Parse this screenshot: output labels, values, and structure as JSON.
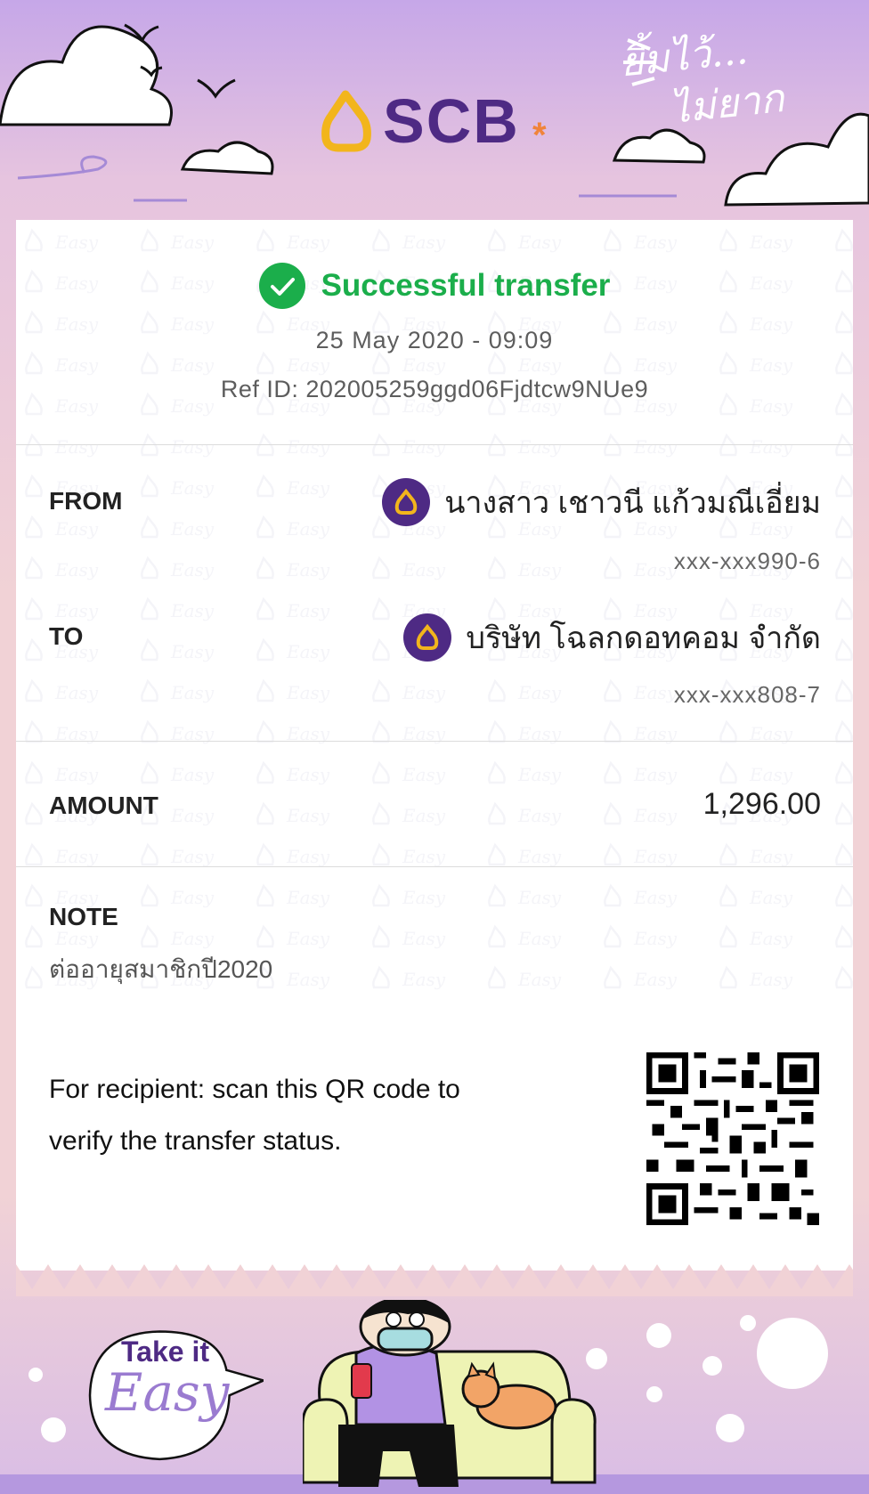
{
  "header": {
    "brand": "SCB",
    "slogan_line1": "ยิ้มไว้...",
    "slogan_line2": "ไม่ยาก"
  },
  "status": {
    "title": "Successful transfer",
    "datetime": "25 May 2020 - 09:09",
    "ref": "Ref ID: 202005259ggd06Fjdtcw9NUe9"
  },
  "from": {
    "label": "FROM",
    "name": "นางสาว เชาวนี แก้วมณีเอี่ยม",
    "account": "xxx-xxx990-6"
  },
  "to": {
    "label": "TO",
    "name": "บริษัท โฉลกดอทคอม จำกัด",
    "account": "xxx-xxx808-7"
  },
  "amount": {
    "label": "AMOUNT",
    "value": "1,296.00"
  },
  "note": {
    "label": "NOTE",
    "value": "ต่ออายุสมาชิกปี2020"
  },
  "qr": {
    "instruction_line1": "For recipient: scan this QR code to",
    "instruction_line2": "verify the transfer status."
  },
  "footer": {
    "bubble_line1": "Take it",
    "bubble_line2": "Easy"
  },
  "colors": {
    "brand_purple": "#4e2a84",
    "brand_gold": "#f2b51c",
    "success_green": "#1bae4b"
  }
}
